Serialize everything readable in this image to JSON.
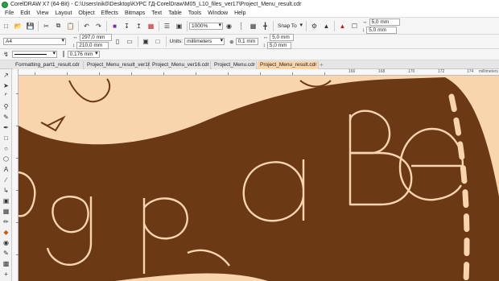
{
  "window": {
    "title": "CorelDRAW X7 (64-Bit) - C:\\Users\\nik0\\Desktop\\КУРС ГД-CorelDraw\\M05_L10_files_ver17\\Project_Menu_result.cdr"
  },
  "menu": [
    "File",
    "Edit",
    "View",
    "Layout",
    "Object",
    "Effects",
    "Bitmaps",
    "Text",
    "Table",
    "Tools",
    "Window",
    "Help"
  ],
  "toolbar": {
    "zoom": "1000%",
    "snap_to": "Snap To",
    "nudge_x": "5,0 mm",
    "nudge_y": "5,0 mm"
  },
  "property_bar": {
    "page_size": "A4",
    "width": "297,0 mm",
    "height": "210,0 mm",
    "units_label": "Units:",
    "units": "millimeters",
    "nudge": "0,1 mm",
    "dup_x": "5,0 mm",
    "dup_y": "5,0 mm"
  },
  "outline": {
    "width": "0,176 mm"
  },
  "tabs": [
    {
      "label": "Formatting_part1_result.cdr",
      "active": false
    },
    {
      "label": "Project_Menu_result_ver16.cdr",
      "active": false
    },
    {
      "label": "Project_Menu_ver16.cdr",
      "active": false
    },
    {
      "label": "Project_Menu.cdr",
      "active": false
    },
    {
      "label": "Project_Menu_result.cdr",
      "active": true
    }
  ],
  "ruler": {
    "numbers": [
      "166",
      "168",
      "170",
      "172",
      "174"
    ],
    "units": "millimeters"
  },
  "colors": {
    "background_shape": "#f9d5ae",
    "band": "#6b3914",
    "letter_stroke": "#f9d5ae",
    "active_tab": "#fbd5a8"
  }
}
